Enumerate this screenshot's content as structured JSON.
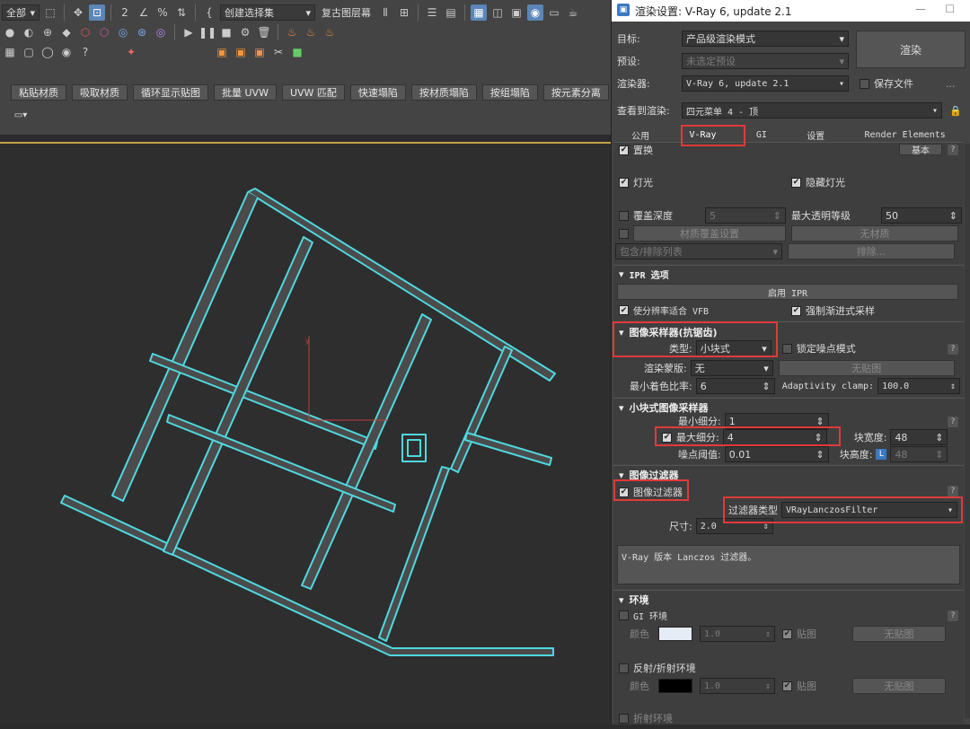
{
  "toolbar": {
    "row1_dropdown_all": "全部",
    "row1_select_set": "创建选择集",
    "row1_restore_layer": "复古图层幕",
    "buttons_row": [
      "粘贴材质",
      "吸取材质",
      "循环显示贴图",
      "批量 UVW",
      "UVW 匹配",
      "快速塌陷",
      "按材质塌陷",
      "按组塌陷",
      "按元素分离"
    ]
  },
  "dialog": {
    "title": "渲染设置: V-Ray 6, update 2.1",
    "target_label": "目标:",
    "target_value": "产品级渲染模式",
    "preset_label": "预设:",
    "preset_value": "未选定预设",
    "renderer_label": "渲染器:",
    "renderer_value": "V-Ray 6, update 2.1",
    "render_button": "渲染",
    "save_file_label": "保存文件",
    "ellipsis": "...",
    "view_label": "查看到渲染:",
    "view_value": "四元菜单 4 - 顶",
    "tabs": [
      "公用",
      "V-Ray",
      "GI",
      "设置",
      "Render Elements"
    ],
    "override_label": "置换",
    "basic_label": "基本",
    "lights_label": "灯光",
    "hidden_lights_label": "隐藏灯光",
    "override_depth_label": "覆盖深度",
    "override_depth_value": "5",
    "max_transp_label": "最大透明等级",
    "max_transp_value": "50",
    "material_override_label": "材质覆盖设置",
    "no_material_label": "无材质",
    "include_exclude_label": "包含/排除列表",
    "exclude_label": "排除...",
    "ipr_title": "IPR 选项",
    "ipr_enable": "启用 IPR",
    "fit_vfb_label": "使分辨率适合 VFB",
    "force_progressive_label": "强制渐进式采样",
    "sampler_title": "图像采样器(抗锯齿)",
    "type_label": "类型:",
    "type_value": "小块式",
    "lock_noise_label": "锁定噪点模式",
    "render_mask_label": "渲染蒙版:",
    "render_mask_value": "无",
    "no_map_label": "无贴图",
    "min_shading_label": "最小着色比率:",
    "min_shading_value": "6",
    "adaptivity_label": "Adaptivity clamp:",
    "adaptivity_value": "100.0",
    "bucket_title": "小块式图像采样器",
    "min_subdiv_label": "最小细分:",
    "min_subdiv_value": "1",
    "max_subdiv_label": "最大细分:",
    "max_subdiv_value": "4",
    "bucket_width_label": "块宽度:",
    "bucket_width_value": "48",
    "noise_thresh_label": "噪点阈值:",
    "noise_thresh_value": "0.01",
    "bucket_height_label": "块高度:",
    "bucket_height_value": "48",
    "bucket_lock": "L",
    "filter_title": "图像过滤器",
    "filter_check_label": "图像过滤器",
    "filter_type_label": "过滤器类型",
    "filter_type_value": "VRayLanczosFilter",
    "size_label": "尺寸:",
    "size_value": "2.0",
    "filter_desc": "V-Ray 版本 Lanczos 过滤器。",
    "env_title": "环境",
    "gi_env_label": "GI 环境",
    "color_label": "颜色",
    "multiplier_value": "1.0",
    "map_label": "贴图",
    "no_map2": "无贴图",
    "refl_env_label": "反射/折射环境",
    "refr_env_label": "折射环境",
    "qmark": "?"
  },
  "colors": {
    "accent_blue": "#5a86b8",
    "highlight_red": "#e03a3a",
    "road_cyan": "#4fd8e0",
    "viewport_border": "#c4a24b"
  }
}
